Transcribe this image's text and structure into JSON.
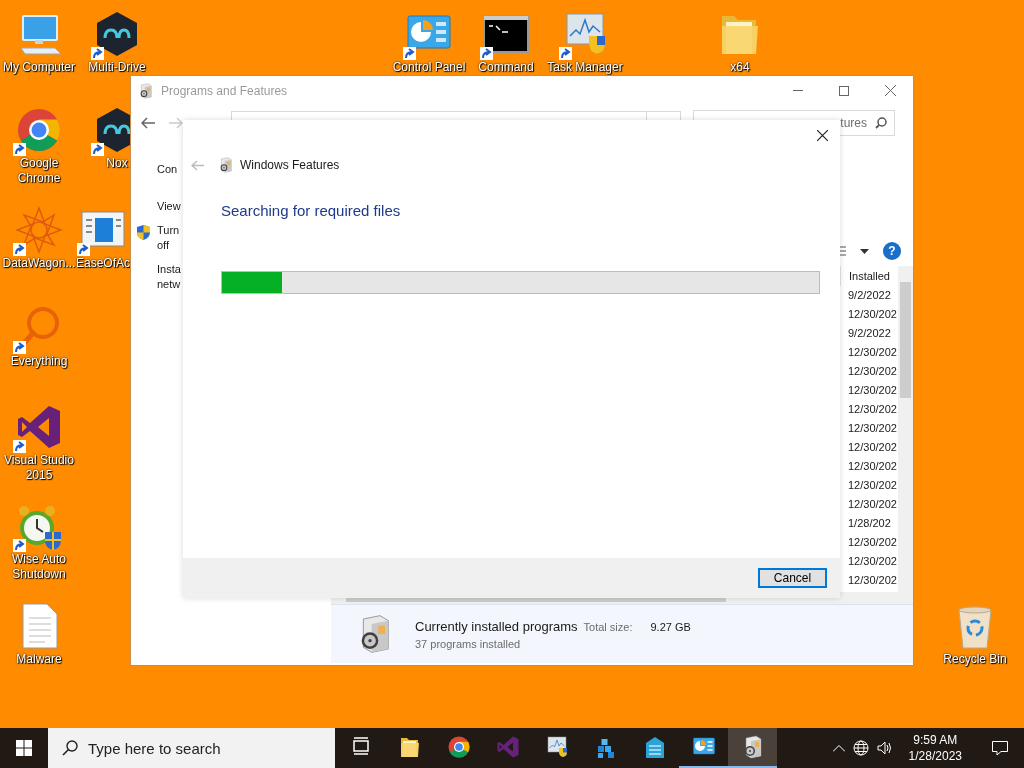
{
  "desktop_icons": [
    {
      "label": "My Computer",
      "kind": "computer",
      "shortcut": false
    },
    {
      "label": "Multi-Drive",
      "kind": "hexapp",
      "shortcut": true
    },
    {
      "label": "Google Chrome",
      "kind": "chrome",
      "shortcut": true
    },
    {
      "label": "Nox",
      "kind": "hexapp",
      "shortcut": true
    },
    {
      "label": "DataWagon...",
      "kind": "star",
      "shortcut": true
    },
    {
      "label": "EaseOfAc",
      "kind": "windowapp",
      "shortcut": true
    },
    {
      "label": "Everything",
      "kind": "magnifier",
      "shortcut": true
    },
    {
      "label": "Visual Studio 2015",
      "kind": "vs",
      "shortcut": true
    },
    {
      "label": "Wise Auto Shutdown",
      "kind": "clock",
      "shortcut": true
    },
    {
      "label": "Malware",
      "kind": "document",
      "shortcut": false
    },
    {
      "label": "Control Panel",
      "kind": "controlpanel",
      "shortcut": true
    },
    {
      "label": "Command",
      "kind": "terminal",
      "shortcut": true
    },
    {
      "label": "Task Manager",
      "kind": "taskmanager",
      "shortcut": true
    },
    {
      "label": "x64",
      "kind": "folder",
      "shortcut": false
    },
    {
      "label": "Recycle Bin",
      "kind": "recyclebin",
      "shortcut": false
    }
  ],
  "window": {
    "title": "Programs and Features",
    "search": {
      "placeholder": "tures"
    },
    "left_pane": [
      {
        "text": "Con",
        "kind": "home"
      },
      {
        "text": "View",
        "kind": "link"
      },
      {
        "text": "Turn off",
        "kind": "shield"
      },
      {
        "text": "Insta netw",
        "kind": "link"
      }
    ],
    "help_button": "?",
    "list": {
      "column": "Installed",
      "rows": [
        "9/2/2022",
        "12/30/202",
        "9/2/2022",
        "12/30/202",
        "12/30/202",
        "12/30/202",
        "12/30/202",
        "12/30/202",
        "12/30/202",
        "12/30/202",
        "12/30/202",
        "12/30/202",
        "1/28/202",
        "12/30/202",
        "12/30/202",
        "12/30/202"
      ]
    },
    "details": {
      "title": "Currently installed programs",
      "size_label": "Total size:",
      "size": "9.27 GB",
      "count": "37 programs installed"
    }
  },
  "dialog": {
    "title": "Windows Features",
    "heading": "Searching for required files",
    "progress": {
      "level": 0.1
    },
    "buttons": [
      "Cancel"
    ]
  },
  "taskbar": {
    "search": {
      "placeholder": "Type here to search"
    },
    "apps": [
      {
        "kind": "taskview",
        "running": false,
        "selected": false
      },
      {
        "kind": "folder",
        "running": false,
        "selected": false
      },
      {
        "kind": "chrome",
        "running": false,
        "selected": false
      },
      {
        "kind": "vs",
        "running": false,
        "selected": false
      },
      {
        "kind": "taskmanager",
        "running": false,
        "selected": false
      },
      {
        "kind": "cubes",
        "running": false,
        "selected": false
      },
      {
        "kind": "building",
        "running": false,
        "selected": false
      },
      {
        "kind": "controlpanel",
        "running": true,
        "selected": false
      },
      {
        "kind": "software",
        "running": true,
        "selected": true
      }
    ],
    "time": "9:59 AM",
    "date": "1/28/2023"
  }
}
